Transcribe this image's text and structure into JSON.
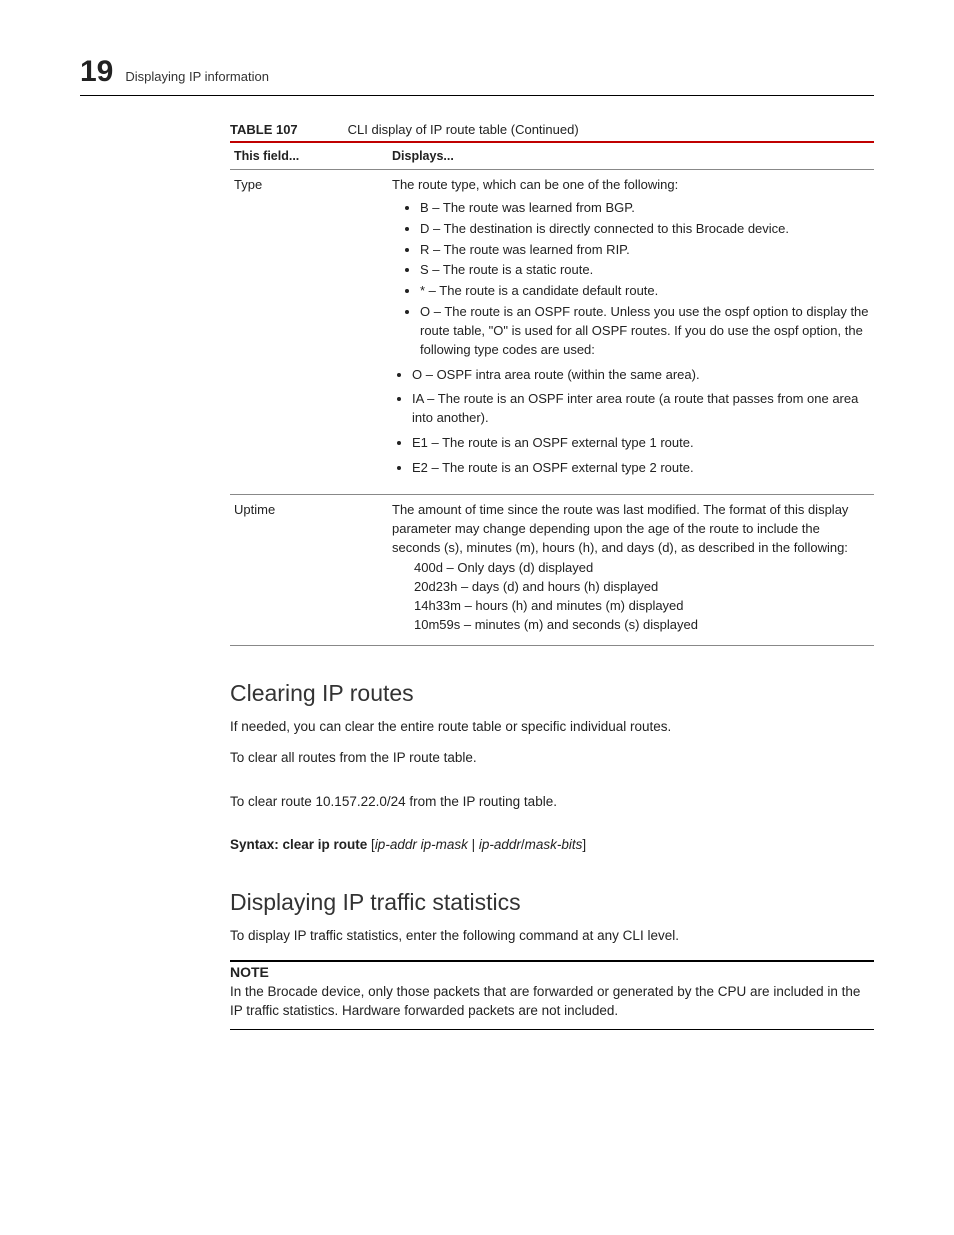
{
  "header": {
    "chapter_number": "19",
    "chapter_title": "Displaying IP information"
  },
  "table": {
    "label": "TABLE 107",
    "caption": "CLI display of IP route table  (Continued)",
    "head_field": "This field...",
    "head_displays": "Displays...",
    "rows": {
      "type": {
        "field": "Type",
        "intro": "The route type, which can be one of the following:",
        "items": {
          "b": "B – The route was learned from BGP.",
          "d": "D – The destination is directly connected to this Brocade device.",
          "r": "R – The route was learned from RIP.",
          "s": "S – The route is a static route.",
          "star": "* – The route is a candidate default route.",
          "o": "O – The route is an OSPF route. Unless you use the ospf option to display the route table, \"O\" is used for all OSPF routes. If you do use the ospf option, the following type codes are used:",
          "o_sub": "O – OSPF intra area route (within the same area).",
          "ia": "IA – The route is an OSPF inter area route (a route that passes from one area into another).",
          "e1": "E1 – The route is an OSPF external type 1 route.",
          "e2": "E2 – The route is an OSPF external type 2 route."
        }
      },
      "uptime": {
        "field": "Uptime",
        "para": "The amount of time since the route was last modified. The format of this display parameter may change depending upon the age of the route to include the seconds (s), minutes (m), hours (h), and days (d), as described in the following:",
        "lines": {
          "a": "400d – Only days (d) displayed",
          "b": "20d23h – days (d) and hours (h) displayed",
          "c": "14h33m – hours (h) and minutes (m) displayed",
          "d": "10m59s – minutes (m) and seconds (s) displayed"
        }
      }
    }
  },
  "sec_clear": {
    "title": "Clearing IP routes",
    "p1": "If needed, you can clear the entire route table or specific individual routes.",
    "p2": "To clear all routes from the IP route table.",
    "p3": "To clear route 10.157.22.0/24 from the IP routing table.",
    "syntax_label": "Syntax:  clear ip route",
    "syntax_open": " [",
    "syntax_arg1": "ip-addr ip-mask",
    "syntax_mid": "   |   ",
    "syntax_arg2": "ip-addr",
    "syntax_slash": "/",
    "syntax_arg3": "mask-bits",
    "syntax_close": "]"
  },
  "sec_stats": {
    "title": "Displaying IP traffic statistics",
    "p1": "To display IP traffic statistics, enter the following command at any CLI level.",
    "note_label": "NOTE",
    "note_body": "In the Brocade device, only those packets that are forwarded or generated by the CPU are included in the IP traffic statistics. Hardware forwarded packets are not included."
  }
}
